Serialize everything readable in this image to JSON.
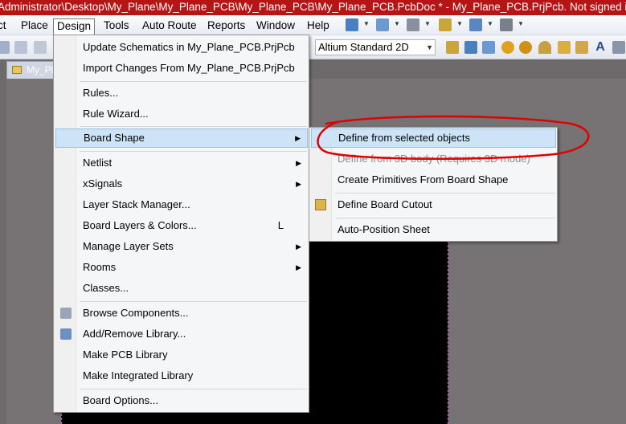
{
  "window": {
    "title": "Administrator\\Desktop\\My_Plane\\My_Plane_PCB\\My_Plane_PCB\\My_Plane_PCB.PcbDoc * - My_Plane_PCB.PrjPcb. Not signed in."
  },
  "menubar": {
    "items": [
      "ct",
      "Place",
      "Design",
      "Tools",
      "Auto Route",
      "Reports",
      "Window",
      "Help"
    ],
    "active": "Design"
  },
  "toolbar": {
    "view_combo": "Altium Standard 2D"
  },
  "document_tab": {
    "label": "My_Pla"
  },
  "design_menu": {
    "items": [
      {
        "label": "Update Schematics in My_Plane_PCB.PrjPcb"
      },
      {
        "label": "Import Changes From My_Plane_PCB.PrjPcb"
      },
      {
        "label": "Rules..."
      },
      {
        "label": "Rule Wizard..."
      },
      {
        "label": "Board Shape",
        "submenu": true
      },
      {
        "label": "Netlist",
        "submenu": true
      },
      {
        "label": "xSignals",
        "submenu": true
      },
      {
        "label": "Layer Stack Manager..."
      },
      {
        "label": "Board Layers & Colors...",
        "shortcut": "L"
      },
      {
        "label": "Manage Layer Sets",
        "submenu": true
      },
      {
        "label": "Rooms",
        "submenu": true
      },
      {
        "label": "Classes..."
      },
      {
        "label": "Browse Components..."
      },
      {
        "label": "Add/Remove Library..."
      },
      {
        "label": "Make PCB Library"
      },
      {
        "label": "Make Integrated Library"
      },
      {
        "label": "Board Options..."
      }
    ],
    "highlighted": "Board Shape"
  },
  "board_shape_submenu": {
    "items": [
      {
        "label": "Define from selected objects"
      },
      {
        "label": "Define from 3D body (Requires 3D mode)",
        "disabled": true
      },
      {
        "label": "Create Primitives From Board Shape"
      },
      {
        "label": "Define Board Cutout"
      },
      {
        "label": "Auto-Position Sheet"
      }
    ],
    "highlighted": "Define from selected objects"
  },
  "colors": {
    "title_bar": "#b51515",
    "highlight": "#cde4f8",
    "annotation": "#e00000"
  }
}
